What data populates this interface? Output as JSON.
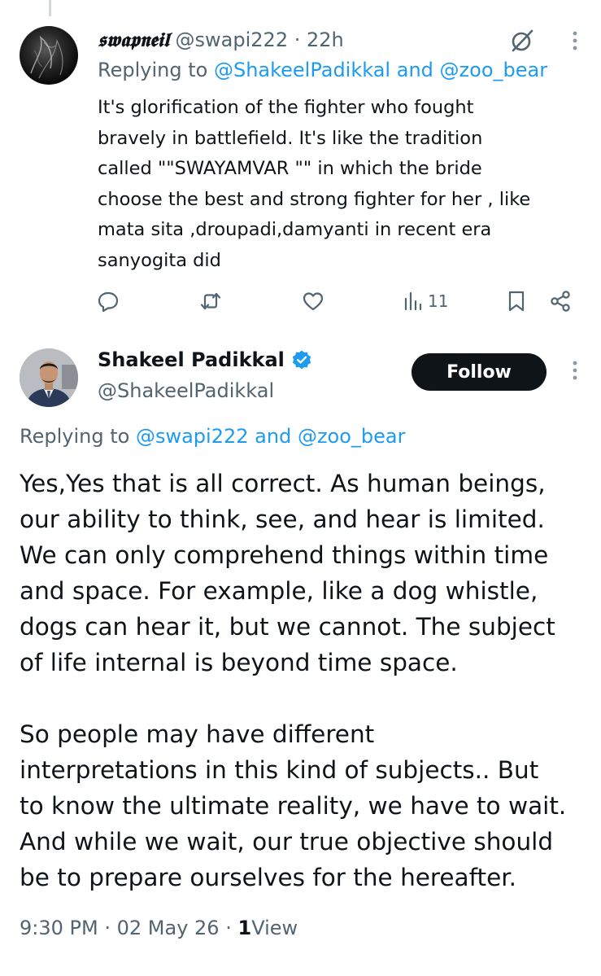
{
  "reply_tweet": {
    "display_name": "𝖘𝖜𝖆𝖕𝖓𝖊𝖎𝖑",
    "handle": "@swapi222",
    "separator": "·",
    "time": "22h",
    "replying_prefix": "Replying to",
    "replying_to_1": "@ShakeelPadikkal",
    "replying_and": "and",
    "replying_to_2": "@zoo_bear",
    "text_lines": [
      "It's glorification of the fighter who fought",
      "bravely in battlefield. It's like the tradition",
      "called \"\"SWAYAMVAR \"\" in which the bride",
      "choose the best and strong fighter for her , like",
      "mata sita ,droupadi,damyanti in recent era",
      "sanyogita did"
    ],
    "views_count": "11",
    "icons": [
      "reply-icon",
      "retweet-icon",
      "like-icon",
      "views-icon",
      "bookmark-icon",
      "share-icon",
      "grok-icon",
      "more-icon"
    ]
  },
  "main_tweet": {
    "display_name": "Shakeel Padikkal",
    "handle": "@ShakeelPadikkal",
    "follow_label": "Follow",
    "replying_prefix": "Replying to",
    "replying_to_1": "@swapi222",
    "replying_and": "and",
    "replying_to_2": "@zoo_bear",
    "paragraph_1_lines": [
      "Yes,Yes that is all correct. As human beings,",
      "our ability to think, see, and hear is limited.",
      "We can only comprehend things within time",
      "and space. For example, like a dog whistle,",
      "dogs can hear it, but we cannot. The subject",
      "of life internal is beyond time space."
    ],
    "paragraph_2_lines": [
      "So people may have different",
      "interpretations in this kind of subjects.. But",
      "to know the ultimate reality, we have to wait.",
      "And while we wait, our true objective should",
      "be to prepare ourselves for the hereafter."
    ],
    "time": "9:30 PM",
    "separator": "·",
    "date": "02 May 26",
    "views_count": "1",
    "views_label": "View"
  },
  "colors": {
    "text": "#0f1419",
    "muted": "#536471",
    "link": "#1d9bf0",
    "verified": "#1d9bf0",
    "follow_bg": "#0f1419"
  }
}
